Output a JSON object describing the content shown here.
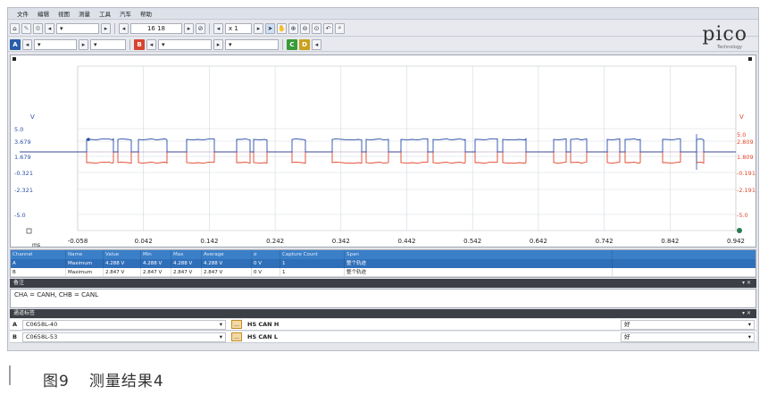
{
  "menu": [
    "文件",
    "编辑",
    "视图",
    "测量",
    "工具",
    "汽车",
    "帮助"
  ],
  "toolbar1": {
    "timebase": "16 18",
    "zoom": "x 1"
  },
  "toolbar2": {
    "channels": [
      {
        "label": "A",
        "color": "#2a5caa"
      },
      {
        "label": "B",
        "color": "#d64530"
      },
      {
        "label": "C",
        "color": "#3a9a3a"
      },
      {
        "label": "D",
        "color": "#c9a11f"
      }
    ]
  },
  "logo": {
    "text": "pico",
    "subtitle": "Technology"
  },
  "scope": {
    "y_unit_left": "V",
    "y_unit_right": "V",
    "x_unit": "ms",
    "left_ticks": [
      "5.0",
      "3.679",
      "1.679",
      "-0.321",
      "-2.321",
      "-5.0"
    ],
    "right_ticks": [
      "5.0",
      "2.809",
      "1.809",
      "-0.191",
      "-2.191",
      "-5.0"
    ],
    "x_ticks": [
      "-0.058",
      "0.042",
      "0.142",
      "0.242",
      "0.342",
      "0.442",
      "0.542",
      "0.642",
      "0.742",
      "0.842",
      "0.942"
    ],
    "color_a": "#2a4ea8",
    "color_b": "#e0452a",
    "frame_segments": [
      [
        85,
        115
      ],
      [
        120,
        135
      ],
      [
        143,
        175
      ],
      [
        197,
        228
      ],
      [
        253,
        268
      ],
      [
        272,
        287
      ],
      [
        315,
        330
      ],
      [
        360,
        393
      ],
      [
        398,
        423
      ],
      [
        437,
        467
      ],
      [
        473,
        509
      ],
      [
        520,
        545
      ],
      [
        551,
        577
      ],
      [
        608,
        622
      ],
      [
        627,
        645
      ],
      [
        668,
        682
      ],
      [
        688,
        705
      ],
      [
        730,
        750
      ],
      [
        768,
        776
      ]
    ]
  },
  "measurements": {
    "headers": [
      "Channel",
      "Name",
      "Value",
      "Min",
      "Max",
      "Average",
      "σ",
      "Capture Count",
      "Span"
    ],
    "rows": [
      [
        "A",
        "Maximum",
        "4.288 V",
        "4.288 V",
        "4.288 V",
        "4.288 V",
        "0 V",
        "1",
        "整个轨迹"
      ],
      [
        "B",
        "Maximum",
        "2.847 V",
        "2.847 V",
        "2.847 V",
        "2.847 V",
        "0 V",
        "1",
        "整个轨迹"
      ]
    ]
  },
  "notes": {
    "title": "备注",
    "text": "CHA = CANH, CHB = CANL"
  },
  "probes": {
    "title": "通道标签",
    "rows": [
      {
        "channel": "A",
        "probe": "C0658L-40",
        "signal": "HS CAN H",
        "status": "好"
      },
      {
        "channel": "B",
        "probe": "C0658L-53",
        "signal": "HS CAN L",
        "status": "好"
      }
    ]
  },
  "caption": {
    "figure": "图9",
    "text": "测量结果4"
  }
}
